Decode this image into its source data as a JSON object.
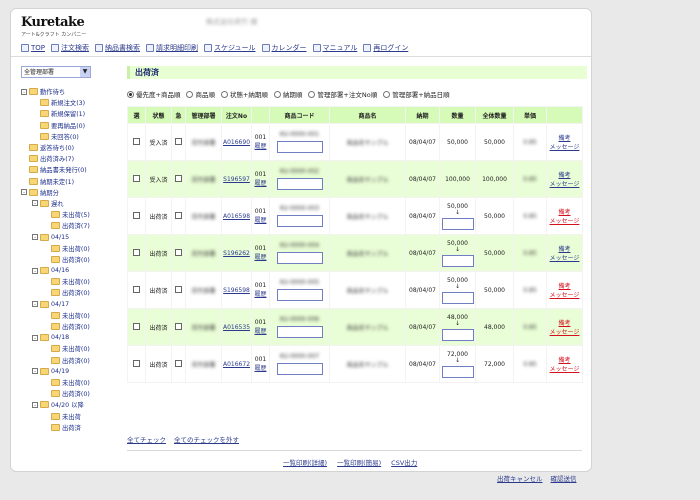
{
  "header": {
    "logo": "Kuretake",
    "logo_sub": "アート&クラフト カンパニー",
    "company": "株式会社呉竹 様"
  },
  "nav": [
    {
      "label": "TOP",
      "icon": "home-icon"
    },
    {
      "label": "注文検索",
      "icon": "search-icon"
    },
    {
      "label": "納品書検索",
      "icon": "document-icon"
    },
    {
      "label": "請求明細印刷",
      "icon": "print-icon"
    },
    {
      "label": "スケジュール",
      "icon": "schedule-icon"
    },
    {
      "label": "カレンダー",
      "icon": "calendar-icon"
    },
    {
      "label": "マニュアル",
      "icon": "manual-icon"
    },
    {
      "label": "再ログイン",
      "icon": "key-icon"
    }
  ],
  "sidebar": {
    "select_value": "全管理部署",
    "tree": [
      {
        "label": "動作待ち",
        "level": 0,
        "toggle": "-"
      },
      {
        "label": "新規注文(3)",
        "level": 1,
        "toggle": ""
      },
      {
        "label": "新規保留(1)",
        "level": 1,
        "toggle": ""
      },
      {
        "label": "要再納品(0)",
        "level": 1,
        "toggle": ""
      },
      {
        "label": "未回答(0)",
        "level": 1,
        "toggle": ""
      },
      {
        "label": "返答待ち(0)",
        "level": 0,
        "toggle": ""
      },
      {
        "label": "出荷済み(7)",
        "level": 0,
        "toggle": ""
      },
      {
        "label": "納品書未発行(0)",
        "level": 0,
        "toggle": ""
      },
      {
        "label": "納期未定(1)",
        "level": 0,
        "toggle": ""
      },
      {
        "label": "納期分",
        "level": 0,
        "toggle": "-"
      },
      {
        "label": "遅れ",
        "level": 1,
        "toggle": "-"
      },
      {
        "label": "未出荷(5)",
        "level": 2,
        "toggle": ""
      },
      {
        "label": "出荷済(7)",
        "level": 2,
        "toggle": ""
      },
      {
        "label": "04/15",
        "level": 1,
        "toggle": "-"
      },
      {
        "label": "未出荷(0)",
        "level": 2,
        "toggle": ""
      },
      {
        "label": "出荷済(0)",
        "level": 2,
        "toggle": ""
      },
      {
        "label": "04/16",
        "level": 1,
        "toggle": "-"
      },
      {
        "label": "未出荷(0)",
        "level": 2,
        "toggle": ""
      },
      {
        "label": "出荷済(0)",
        "level": 2,
        "toggle": ""
      },
      {
        "label": "04/17",
        "level": 1,
        "toggle": "-"
      },
      {
        "label": "未出荷(0)",
        "level": 2,
        "toggle": ""
      },
      {
        "label": "出荷済(0)",
        "level": 2,
        "toggle": ""
      },
      {
        "label": "04/18",
        "level": 1,
        "toggle": "-"
      },
      {
        "label": "未出荷(0)",
        "level": 2,
        "toggle": ""
      },
      {
        "label": "出荷済(0)",
        "level": 2,
        "toggle": ""
      },
      {
        "label": "04/19",
        "level": 1,
        "toggle": "-"
      },
      {
        "label": "未出荷(0)",
        "level": 2,
        "toggle": ""
      },
      {
        "label": "出荷済(0)",
        "level": 2,
        "toggle": ""
      },
      {
        "label": "04/20 以降",
        "level": 1,
        "toggle": "-"
      },
      {
        "label": "未出荷",
        "level": 2,
        "toggle": ""
      },
      {
        "label": "出荷済",
        "level": 2,
        "toggle": ""
      }
    ]
  },
  "main": {
    "title": "出荷済",
    "sort_options": [
      {
        "label": "優先度+商品順",
        "selected": true
      },
      {
        "label": "商品順",
        "selected": false
      },
      {
        "label": "状態+納期順",
        "selected": false
      },
      {
        "label": "納期順",
        "selected": false
      },
      {
        "label": "管理部署+注文No順",
        "selected": false
      },
      {
        "label": "管理部署+納品日順",
        "selected": false
      }
    ],
    "table": {
      "headers": [
        "選",
        "状態",
        "急",
        "管理部署",
        "注文No",
        "",
        "商品コード",
        "商品名",
        "納期",
        "数量",
        "全体数量",
        "単価",
        ""
      ],
      "rows": [
        {
          "status": "受入済",
          "dept": "呉竹部署",
          "order_no": "A016690",
          "seq": "001",
          "history": "履歴",
          "code": "KU-0000-001",
          "name": "商品名サンプル",
          "due": "08/04/07",
          "qty_from": "",
          "qty": "50,000",
          "total": "50,000",
          "price": "0.85",
          "msg_top": "備考",
          "msg_bottom": "メッセージ",
          "msg_color": "blue"
        },
        {
          "status": "受入済",
          "dept": "呉竹部署",
          "order_no": "S196597",
          "seq": "001",
          "history": "履歴",
          "code": "KU-0000-002",
          "name": "商品名サンプル",
          "due": "08/04/07",
          "qty_from": "",
          "qty": "100,000",
          "total": "100,000",
          "price": "0.85",
          "msg_top": "備考",
          "msg_bottom": "メッセージ",
          "msg_color": "blue"
        },
        {
          "status": "出荷済",
          "dept": "呉竹部署",
          "order_no": "A016598",
          "seq": "001",
          "history": "履歴",
          "code": "KU-0000-003",
          "name": "商品名サンプル",
          "due": "08/04/07",
          "qty_from": "50,000",
          "qty": "",
          "total": "50,000",
          "price": "0.85",
          "msg_top": "備考",
          "msg_bottom": "メッセージ",
          "msg_color": "red"
        },
        {
          "status": "出荷済",
          "dept": "呉竹部署",
          "order_no": "S196262",
          "seq": "001",
          "history": "履歴",
          "code": "KU-0000-004",
          "name": "商品名サンプル",
          "due": "08/04/07",
          "qty_from": "50,000",
          "qty": "",
          "total": "50,000",
          "price": "0.85",
          "msg_top": "備考",
          "msg_bottom": "メッセージ",
          "msg_color": "blue"
        },
        {
          "status": "出荷済",
          "dept": "呉竹部署",
          "order_no": "S196598",
          "seq": "001",
          "history": "履歴",
          "code": "KU-0000-005",
          "name": "商品名サンプル",
          "due": "08/04/07",
          "qty_from": "50,000",
          "qty": "",
          "total": "50,000",
          "price": "0.85",
          "msg_top": "備考",
          "msg_bottom": "メッセージ",
          "msg_color": "red"
        },
        {
          "status": "出荷済",
          "dept": "呉竹部署",
          "order_no": "A016535",
          "seq": "001",
          "history": "履歴",
          "code": "KU-0000-006",
          "name": "商品名サンプル",
          "due": "08/04/07",
          "qty_from": "48,000",
          "qty": "",
          "total": "48,000",
          "price": "0.85",
          "msg_top": "備考",
          "msg_bottom": "メッセージ",
          "msg_color": "red"
        },
        {
          "status": "出荷済",
          "dept": "呉竹部署",
          "order_no": "A016672",
          "seq": "001",
          "history": "履歴",
          "code": "KU-0000-007",
          "name": "商品名サンプル",
          "due": "08/04/07",
          "qty_from": "72,000",
          "qty": "",
          "total": "72,000",
          "price": "0.85",
          "msg_top": "備考",
          "msg_bottom": "メッセージ",
          "msg_color": "red"
        }
      ]
    },
    "check_all": "全てチェック",
    "uncheck_all": "全てのチェックを外す",
    "print_detail": "一覧印刷(詳細)",
    "print_simple": "一覧印刷(簡易)",
    "csv": "CSV出力",
    "cancel_ship": "出荷キャンセル",
    "confirm_send": "確認送信"
  }
}
